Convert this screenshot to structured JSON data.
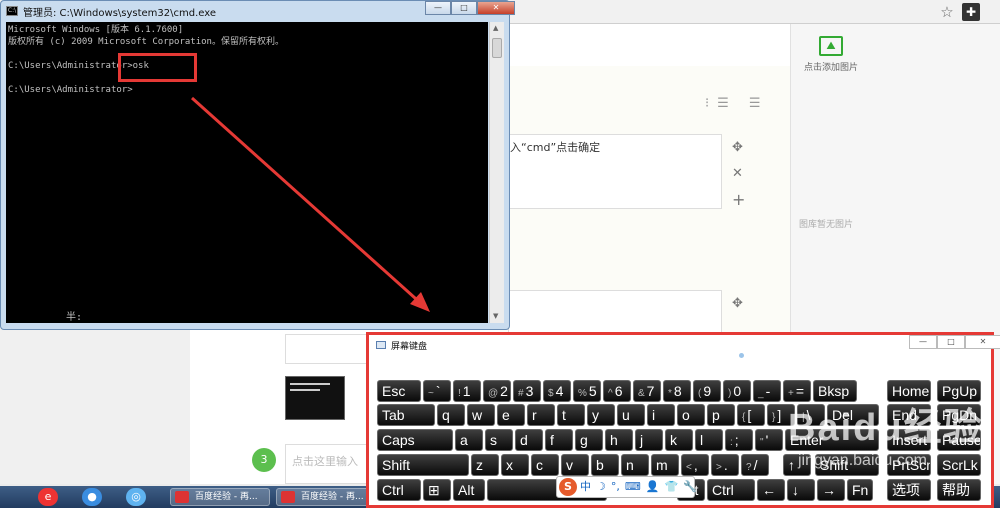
{
  "cmd": {
    "title": "管理员: C:\\Windows\\system32\\cmd.exe",
    "icon": "C:\\",
    "lines": [
      "Microsoft Windows [版本 6.1.7600]",
      "版权所有 (c) 2009 Microsoft Corporation。保留所有权利。",
      "",
      "C:\\Users\\Administrator>osk",
      "",
      "C:\\Users\\Administrator>"
    ],
    "ime_status": "半:",
    "buttons": {
      "minimize": "—",
      "maximize": "□",
      "close": "✕"
    }
  },
  "page": {
    "add_image_label": "点击添加图片",
    "no_image_label": "图库暂无图片",
    "step_text": "入“cmd”点击确定",
    "step_number": "3",
    "step_placeholder": "点击这里输入",
    "tools": {
      "move": "✥",
      "delete": "✕",
      "add": "+"
    },
    "list_icons": "⁝☰ ☰"
  },
  "taskbar": {
    "tasks": [
      "百度经验 - 再...",
      "百度经验 - 再..."
    ]
  },
  "osk": {
    "title": "屏幕键盘",
    "buttons": {
      "minimize": "—",
      "maximize": "□",
      "close": "✕"
    },
    "rows": [
      [
        {
          "id": "esc",
          "label": "Esc"
        },
        {
          "id": "tilde",
          "shift": "~",
          "label": "`"
        },
        {
          "id": "1",
          "shift": "!",
          "label": "1"
        },
        {
          "id": "2",
          "shift": "@",
          "label": "2"
        },
        {
          "id": "3",
          "shift": "#",
          "label": "3"
        },
        {
          "id": "4",
          "shift": "$",
          "label": "4"
        },
        {
          "id": "5",
          "shift": "%",
          "label": "5"
        },
        {
          "id": "6",
          "shift": "^",
          "label": "6"
        },
        {
          "id": "7",
          "shift": "&",
          "label": "7"
        },
        {
          "id": "8",
          "shift": "*",
          "label": "8"
        },
        {
          "id": "9",
          "shift": "(",
          "label": "9"
        },
        {
          "id": "0",
          "shift": ")",
          "label": "0"
        },
        {
          "id": "minus",
          "shift": "_",
          "label": "-"
        },
        {
          "id": "equals",
          "shift": "+",
          "label": "="
        },
        {
          "id": "bksp",
          "label": "Bksp"
        },
        {
          "id": "home",
          "label": "Home"
        },
        {
          "id": "pgup",
          "label": "PgUp"
        }
      ],
      [
        {
          "id": "tab",
          "label": "Tab"
        },
        {
          "id": "q",
          "label": "q"
        },
        {
          "id": "w",
          "label": "w"
        },
        {
          "id": "e",
          "label": "e"
        },
        {
          "id": "r",
          "label": "r"
        },
        {
          "id": "t",
          "label": "t"
        },
        {
          "id": "y",
          "label": "y"
        },
        {
          "id": "u",
          "label": "u"
        },
        {
          "id": "i",
          "label": "i"
        },
        {
          "id": "o",
          "label": "o"
        },
        {
          "id": "p",
          "label": "p"
        },
        {
          "id": "lbracket",
          "shift": "{",
          "label": "["
        },
        {
          "id": "rbracket",
          "shift": "}",
          "label": "]"
        },
        {
          "id": "backslash",
          "shift": "|",
          "label": "\\"
        },
        {
          "id": "del",
          "label": "Del"
        },
        {
          "id": "end",
          "label": "End"
        },
        {
          "id": "pgdn",
          "label": "PgDn"
        }
      ],
      [
        {
          "id": "caps",
          "label": "Caps"
        },
        {
          "id": "a",
          "label": "a"
        },
        {
          "id": "s",
          "label": "s"
        },
        {
          "id": "d",
          "label": "d"
        },
        {
          "id": "f",
          "label": "f"
        },
        {
          "id": "g",
          "label": "g"
        },
        {
          "id": "h",
          "label": "h"
        },
        {
          "id": "j",
          "label": "j"
        },
        {
          "id": "k",
          "label": "k"
        },
        {
          "id": "l",
          "label": "l"
        },
        {
          "id": "semicolon",
          "shift": ":",
          "label": ";"
        },
        {
          "id": "quote",
          "shift": "\"",
          "label": "'"
        },
        {
          "id": "enter",
          "label": "Enter"
        },
        {
          "id": "insert",
          "label": "Insert"
        },
        {
          "id": "pause",
          "label": "Pause"
        }
      ],
      [
        {
          "id": "lshift",
          "label": "Shift"
        },
        {
          "id": "z",
          "label": "z"
        },
        {
          "id": "x",
          "label": "x"
        },
        {
          "id": "c",
          "label": "c"
        },
        {
          "id": "v",
          "label": "v"
        },
        {
          "id": "b",
          "label": "b"
        },
        {
          "id": "n",
          "label": "n"
        },
        {
          "id": "m",
          "label": "m"
        },
        {
          "id": "comma",
          "shift": "<",
          "label": ","
        },
        {
          "id": "period",
          "shift": ">",
          "label": "."
        },
        {
          "id": "slash",
          "shift": "?",
          "label": "/"
        },
        {
          "id": "up",
          "label": "↑"
        },
        {
          "id": "rshift",
          "label": "Shift"
        },
        {
          "id": "prtscn",
          "label": "PrtScn"
        },
        {
          "id": "scrlk",
          "label": "ScrLk"
        }
      ],
      [
        {
          "id": "lctrl",
          "label": "Ctrl"
        },
        {
          "id": "win",
          "label": "⊞"
        },
        {
          "id": "lalt",
          "label": "Alt"
        },
        {
          "id": "space",
          "label": ""
        },
        {
          "id": "ralt",
          "label": "Alt"
        },
        {
          "id": "rctrl",
          "label": "Ctrl"
        },
        {
          "id": "left",
          "label": "←"
        },
        {
          "id": "down",
          "label": "↓"
        },
        {
          "id": "right",
          "label": "→"
        },
        {
          "id": "fn",
          "label": "Fn"
        },
        {
          "id": "options",
          "label": "选项"
        },
        {
          "id": "help",
          "label": "帮助"
        }
      ]
    ],
    "ime_bar": {
      "logo": "S",
      "mode": "中",
      "items": [
        "☽",
        "°,",
        "⌨",
        "👤",
        "👕",
        "🔧"
      ]
    }
  },
  "watermark": {
    "brand": "Baidu经验",
    "url": "jingyan.baidu.com"
  }
}
